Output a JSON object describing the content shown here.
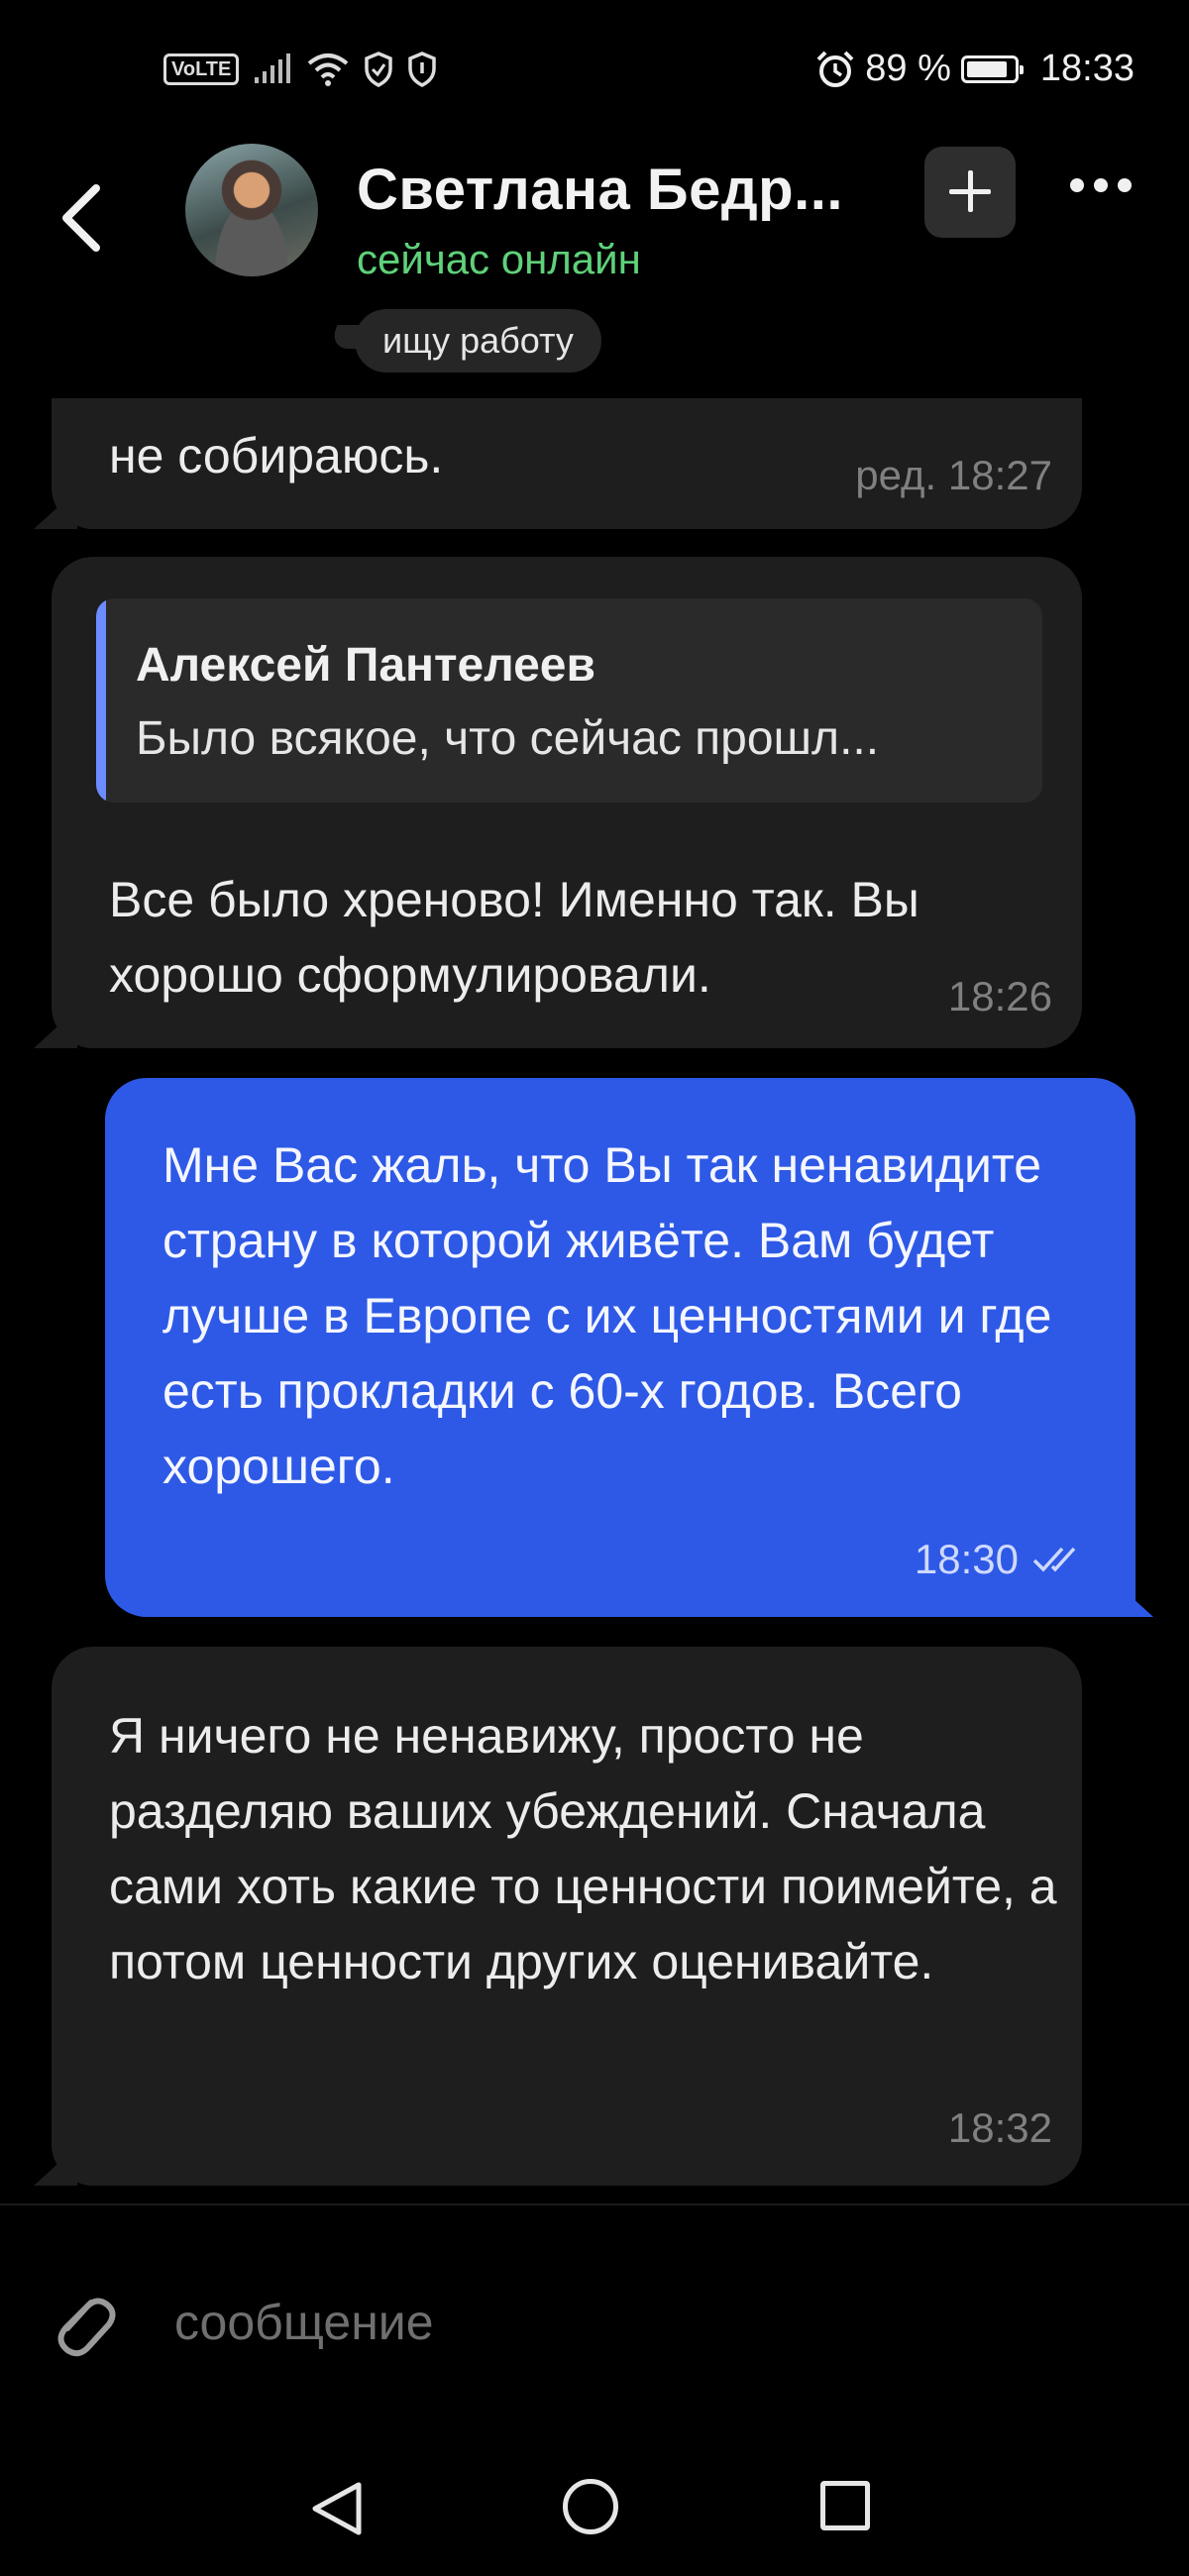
{
  "status_bar": {
    "network_badge": "VoLTE",
    "battery_percent": "89 %",
    "battery_level": 0.89,
    "time": "18:33"
  },
  "header": {
    "contact_name": "Светлана Бедр...",
    "presence": "сейчас онлайн",
    "status_note": "ищу работу"
  },
  "messages": [
    {
      "direction": "in",
      "text": "не собираюсь.",
      "meta": "ред. 18:27"
    },
    {
      "direction": "in",
      "reply_to": {
        "author": "Алексей Пантелеев",
        "snippet": "Было всякое, что сейчас прошл..."
      },
      "text": "Все было хреново! Именно так. Вы хорошо сформулировали.",
      "meta": "18:26"
    },
    {
      "direction": "out",
      "text": "Мне Вас жаль, что Вы так ненавидите страну в которой живёте. Вам будет лучше в Европе с их ценностями и где есть прокладки с 60-х годов. Всего хорошего.",
      "meta": "18:30",
      "read": true
    },
    {
      "direction": "in",
      "text": "Я ничего не ненавижу, просто не разделяю ваших убеждений. Сначала сами хоть какие то ценности поимейте, а потом ценности других оценивайте.",
      "meta": "18:32"
    }
  ],
  "composer": {
    "placeholder": "сообщение"
  },
  "colors": {
    "background": "#000000",
    "incoming_bubble": "#1e1e1e",
    "outgoing_bubble": "#2e59e6",
    "online": "#5fd17a",
    "quote_bar": "#6c8cff"
  }
}
